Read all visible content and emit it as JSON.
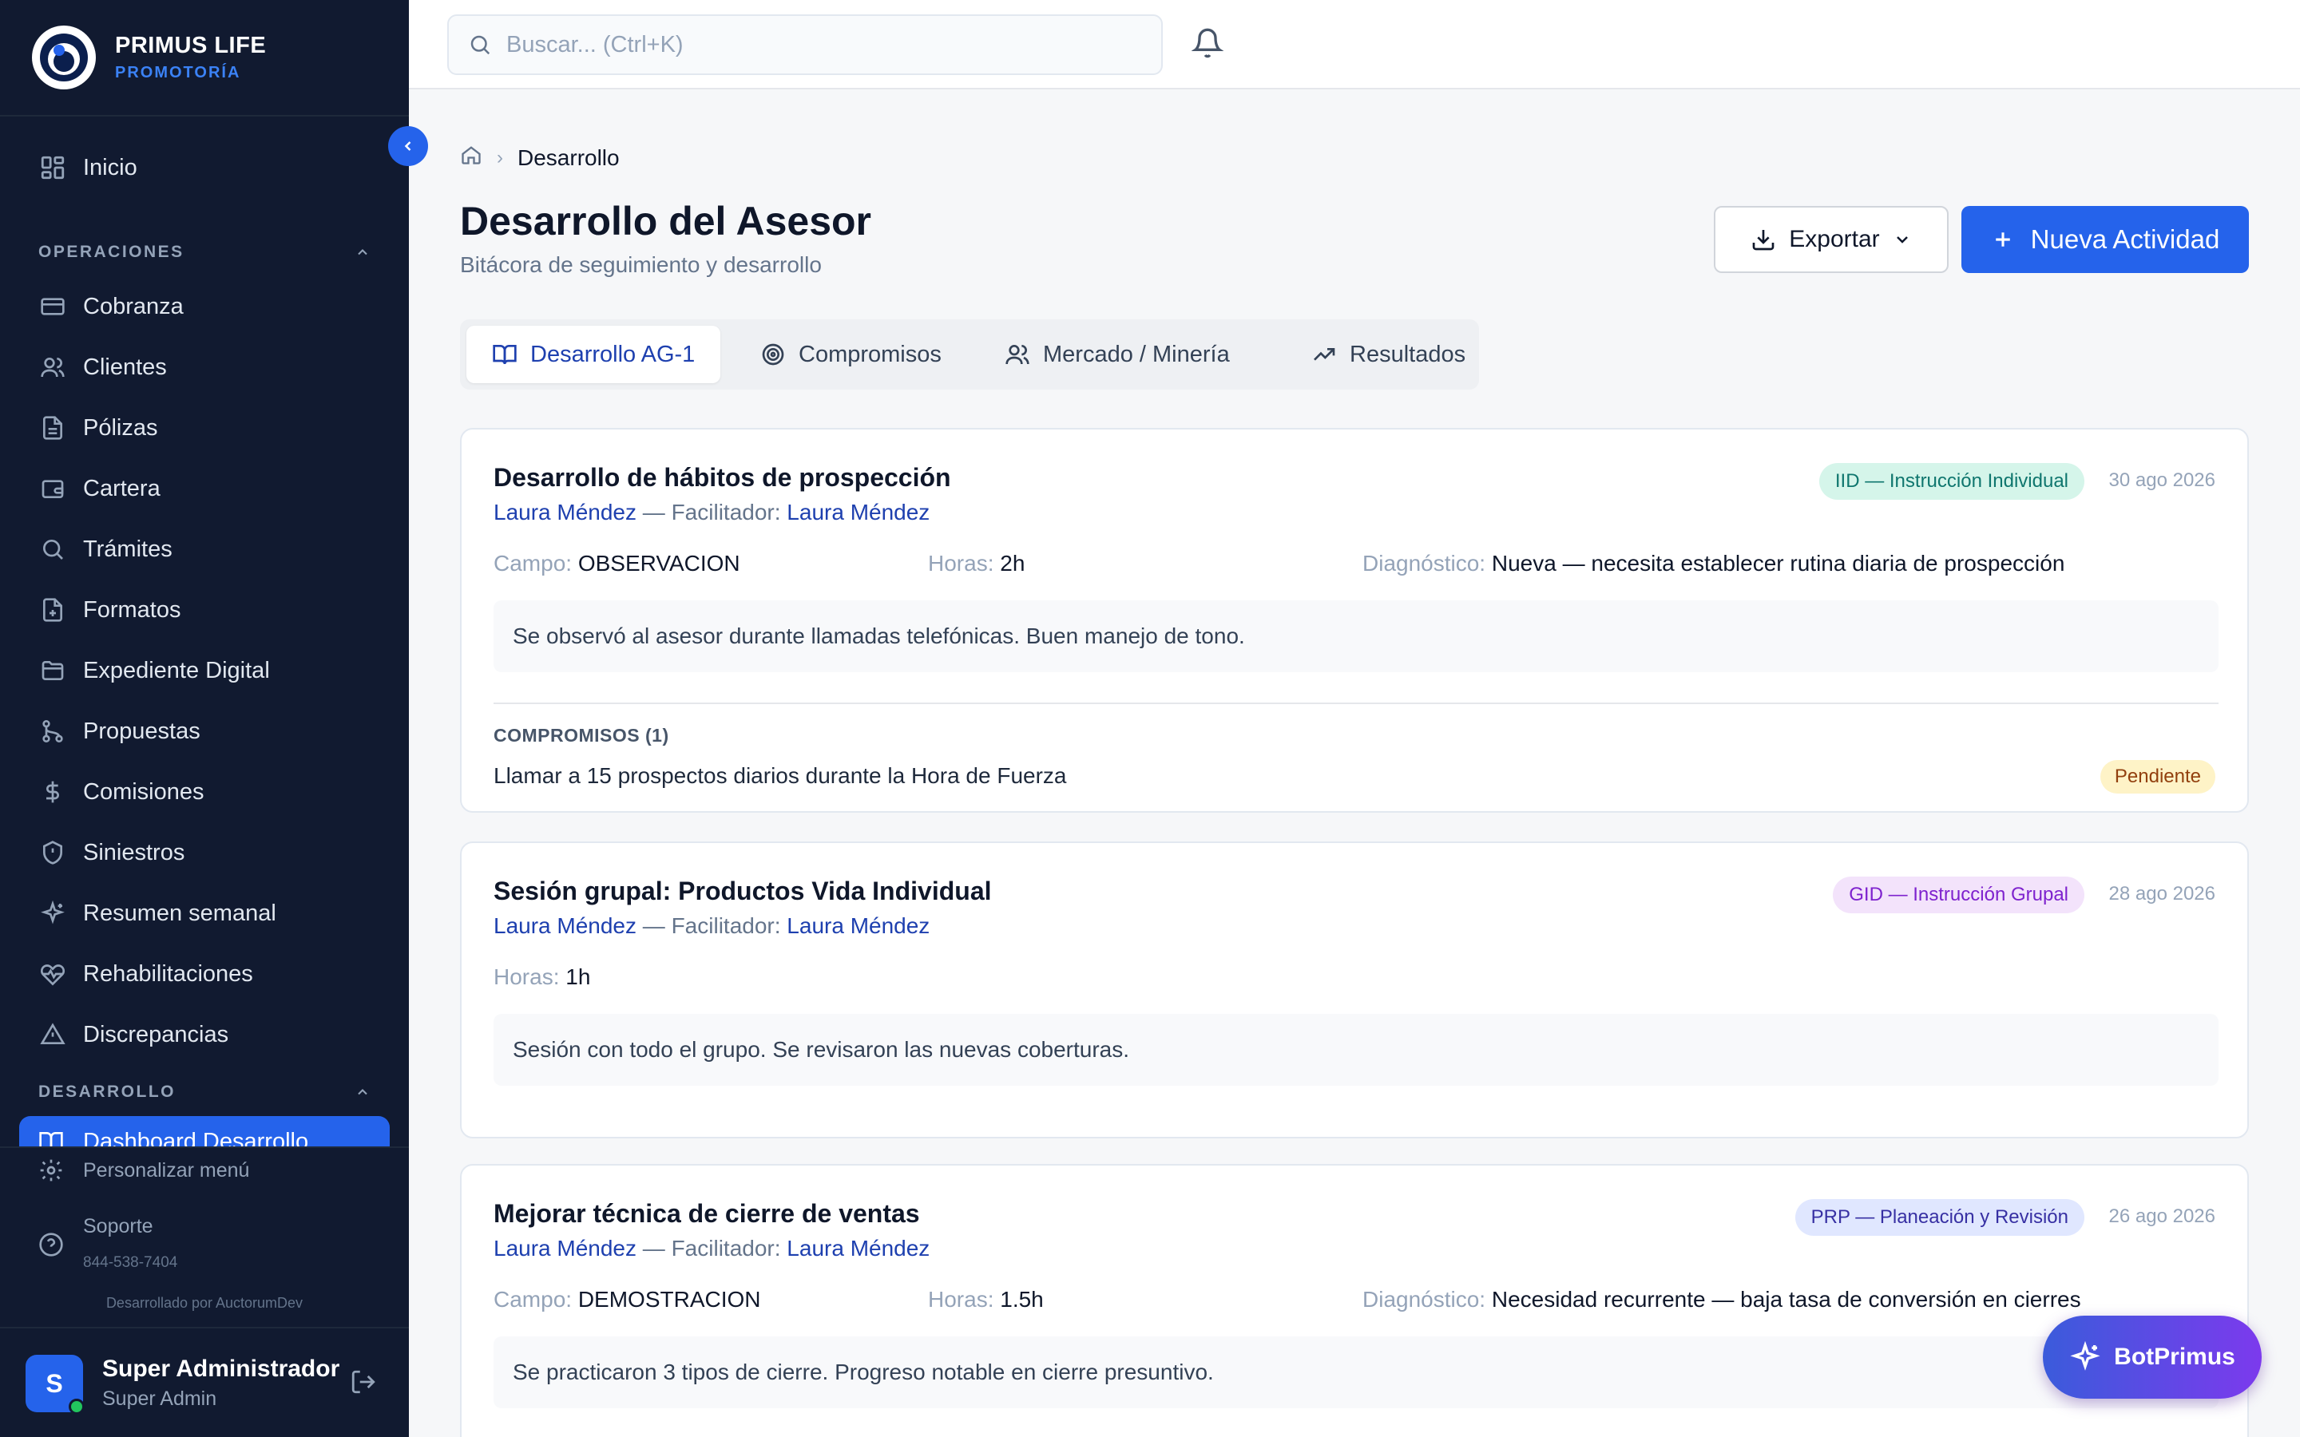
{
  "brand": {
    "name": "PRIMUS LIFE",
    "sub": "PROMOTORÍA"
  },
  "sidebar": {
    "home": "Inicio",
    "sections": {
      "operaciones": "OPERACIONES",
      "desarrollo": "DESARROLLO"
    },
    "items": [
      {
        "label": "Cobranza",
        "icon": "credit-card-icon"
      },
      {
        "label": "Clientes",
        "icon": "users-icon"
      },
      {
        "label": "Pólizas",
        "icon": "document-icon"
      },
      {
        "label": "Cartera",
        "icon": "wallet-icon"
      },
      {
        "label": "Trámites",
        "icon": "search-icon"
      },
      {
        "label": "Formatos",
        "icon": "file-plus-icon"
      },
      {
        "label": "Expediente Digital",
        "icon": "folder-icon"
      },
      {
        "label": "Propuestas",
        "icon": "git-branch-icon"
      },
      {
        "label": "Comisiones",
        "icon": "dollar-icon"
      },
      {
        "label": "Siniestros",
        "icon": "shield-icon"
      },
      {
        "label": "Resumen semanal",
        "icon": "sparkles-icon"
      },
      {
        "label": "Rehabilitaciones",
        "icon": "heart-pulse-icon"
      },
      {
        "label": "Discrepancias",
        "icon": "warning-icon"
      }
    ],
    "active_item": "Dashboard Desarrollo",
    "customize": "Personalizar menú",
    "support": "Soporte",
    "support_phone": "844-538-7404",
    "credit": "Desarrollado por AuctorumDev",
    "user": {
      "initial": "S",
      "name": "Super Administrador",
      "role": "Super Admin"
    }
  },
  "search": {
    "placeholder": "Buscar... (Ctrl+K)"
  },
  "breadcrumb": {
    "current": "Desarrollo"
  },
  "page": {
    "title": "Desarrollo del Asesor",
    "subtitle": "Bitácora de seguimiento y desarrollo",
    "export_label": "Exportar",
    "new_label": "Nueva Actividad"
  },
  "tabs": [
    {
      "label": "Desarrollo AG-1",
      "active": true
    },
    {
      "label": "Compromisos",
      "active": false
    },
    {
      "label": "Mercado / Minería",
      "active": false
    },
    {
      "label": "Resultados",
      "active": false
    }
  ],
  "labels": {
    "facilitator": "— Facilitador:",
    "campo": "Campo:",
    "horas": "Horas:",
    "diagnostico": "Diagnóstico:"
  },
  "activities": [
    {
      "title": "Desarrollo de hábitos de prospección",
      "advisor": "Laura Méndez",
      "facilitator": "Laura Méndez",
      "type": "IID — Instrucción Individual",
      "date": "30 ago 2026",
      "campo": "OBSERVACION",
      "horas": "2h",
      "diagnostico": "Nueva — necesita establecer rutina diaria de prospección",
      "note": "Se observó al asesor durante llamadas telefónicas. Buen manejo de tono.",
      "commitments_title": "COMPROMISOS (1)",
      "commitments": [
        {
          "text": "Llamar a 15 prospectos diarios durante la Hora de Fuerza",
          "status": "Pendiente"
        }
      ]
    },
    {
      "title": "Sesión grupal: Productos Vida Individual",
      "advisor": "Laura Méndez",
      "facilitator": "Laura Méndez",
      "type": "GID — Instrucción Grupal",
      "date": "28 ago 2026",
      "horas": "1h",
      "note": "Sesión con todo el grupo. Se revisaron las nuevas coberturas."
    },
    {
      "title": "Mejorar técnica de cierre de ventas",
      "advisor": "Laura Méndez",
      "facilitator": "Laura Méndez",
      "type": "PRP — Planeación y Revisión",
      "date": "26 ago 2026",
      "campo": "DEMOSTRACION",
      "horas": "1.5h",
      "diagnostico": "Necesidad recurrente — baja tasa de conversión en cierres",
      "note": "Se practicaron 3 tipos de cierre. Progreso notable en cierre presuntivo."
    }
  ],
  "bot": {
    "label": "BotPrimus"
  },
  "colors": {
    "accent": "#2563eb",
    "sidebar_bg": "#111a30"
  }
}
